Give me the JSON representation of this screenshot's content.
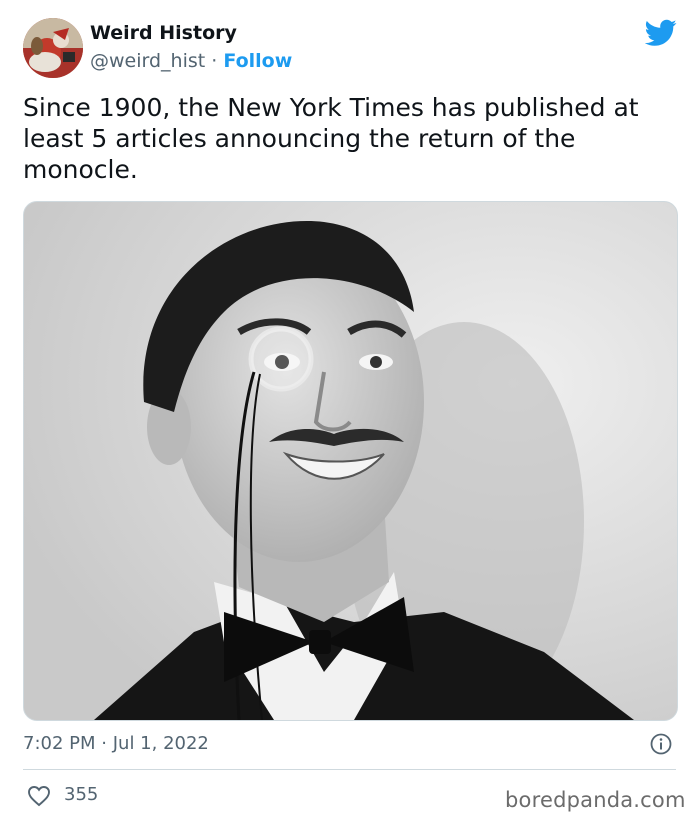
{
  "author": {
    "name": "Weird History",
    "handle": "@weird_hist",
    "separator": "·",
    "follow_label": "Follow",
    "avatar_icon": "avatar-santa-icon"
  },
  "tweet": {
    "text": "Since 1900, the New York Times has published at least 5 articles announcing the return of the monocle.",
    "time": "7:02 PM",
    "date_separator": "·",
    "date": "Jul 1, 2022",
    "likes": "355"
  },
  "icons": {
    "brand": "twitter-bird-icon",
    "info": "info-icon",
    "like": "heart-icon"
  },
  "colors": {
    "accent": "#1d9bf0",
    "text": "#0f1419",
    "muted": "#536471",
    "border": "#cfd9de"
  },
  "watermark": "boredpanda.com"
}
